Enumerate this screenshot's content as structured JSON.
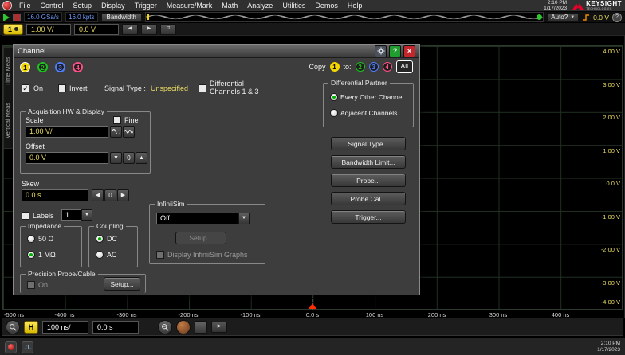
{
  "menu": {
    "items": [
      "File",
      "Control",
      "Setup",
      "Display",
      "Trigger",
      "Measure/Mark",
      "Math",
      "Analyze",
      "Utilities",
      "Demos",
      "Help"
    ],
    "clock_time": "2:10 PM",
    "clock_date": "1/17/2023",
    "brand": "KEYSIGHT",
    "brand_sub": "TECHNOLOGIES"
  },
  "acq_bar": {
    "sample_rate": "16.0 GSa/s",
    "memory": "16.0 kpts",
    "bandwidth_label": "Bandwidth",
    "trigger_mode": "Auto?",
    "trigger_level": "0.0 V"
  },
  "channel_bar": {
    "channel": "1",
    "scale": "1.00 V/",
    "offset": "0.0 V"
  },
  "side_tabs": {
    "time": "Time Meas",
    "vertical": "Vertical Meas"
  },
  "dialog": {
    "title": "Channel",
    "tabs": [
      "1",
      "2",
      "3",
      "4"
    ],
    "copy_label": "Copy",
    "copy_source": "1",
    "copy_to_label": "to:",
    "copy_targets": [
      "2",
      "3",
      "4",
      "All"
    ],
    "on_label": "On",
    "invert_label": "Invert",
    "signal_type_label": "Signal Type :",
    "signal_type_value": "Unspecified",
    "diff_line1": "Differential",
    "diff_line2": "Channels 1 & 3",
    "zero_label": "0",
    "acq_group": {
      "title": "Acquisition HW & Display",
      "scale_label": "Scale",
      "fine_label": "Fine",
      "scale_value": "1.00 V/",
      "offset_label": "Offset",
      "offset_value": "0.0 V"
    },
    "skew_label": "Skew",
    "skew_value": "0.0 s",
    "labels_label": "Labels",
    "labels_value": "1",
    "impedance": {
      "title": "Impedance",
      "options": [
        "50 Ω",
        "1 MΩ"
      ]
    },
    "coupling": {
      "title": "Coupling",
      "options": [
        "DC",
        "AC"
      ]
    },
    "infiniisim": {
      "title": "InfiniiSim",
      "value": "Off",
      "setup_label": "Setup...",
      "graphs_label": "Display InfiniiSim Graphs"
    },
    "precision": {
      "title": "Precision Probe/Cable",
      "on_label": "On",
      "setup_label": "Setup..."
    },
    "diff_partner": {
      "title": "Differential Partner",
      "options": [
        "Every Other Channel",
        "Adjacent Channels"
      ]
    },
    "side_buttons": [
      "Signal Type...",
      "Bandwidth Limit...",
      "Probe...",
      "Probe Cal...",
      "Trigger..."
    ]
  },
  "graticule": {
    "v_labels": [
      "4.00 V",
      "3.00 V",
      "2.00 V",
      "1.00 V",
      "0.0 V",
      "-1.00 V",
      "-2.00 V",
      "-3.00 V",
      "-4.00 V"
    ],
    "t_labels": [
      "-500 ns",
      "-400 ns",
      "-300 ns",
      "-200 ns",
      "-100 ns",
      "0.0 s",
      "100 ns",
      "200 ns",
      "300 ns",
      "400 ns"
    ]
  },
  "hbar": {
    "h_label": "H",
    "timebase": "100 ns/",
    "position": "0.0 s"
  },
  "status": {
    "time": "2:10 PM",
    "date": "1/17/2023"
  },
  "colors": {
    "ch1": "#f2d600",
    "ch2": "#1fbf1f",
    "ch3": "#4f7dff",
    "ch4": "#ff4f86",
    "keysight_red": "#e90029",
    "value_yellow": "#e9dc62",
    "run_green": "#2ec52e"
  }
}
